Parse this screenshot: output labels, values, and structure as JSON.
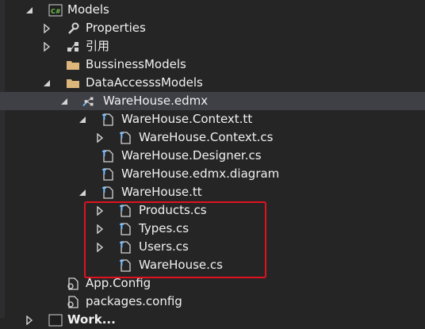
{
  "tree": {
    "items": [
      {
        "label": "Models",
        "icon": "csharp-project-icon",
        "expander": "expanded"
      },
      {
        "label": "Properties",
        "icon": "wrench-icon",
        "expander": "collapsed"
      },
      {
        "label": "引用",
        "icon": "references-icon",
        "expander": "collapsed"
      },
      {
        "label": "BussinessModels",
        "icon": "folder-icon",
        "expander": "none"
      },
      {
        "label": "DataAccesssModels",
        "icon": "folder-icon",
        "expander": "expanded"
      },
      {
        "label": "WareHouse.edmx",
        "icon": "edmx-icon",
        "expander": "expanded",
        "selected": true
      },
      {
        "label": "WareHouse.Context.tt",
        "icon": "tt-file-icon",
        "expander": "expanded"
      },
      {
        "label": "WareHouse.Context.cs",
        "icon": "cs-file-icon",
        "expander": "collapsed"
      },
      {
        "label": "WareHouse.Designer.cs",
        "icon": "cs-file-icon",
        "expander": "none"
      },
      {
        "label": "WareHouse.edmx.diagram",
        "icon": "cs-file-icon",
        "expander": "none"
      },
      {
        "label": "WareHouse.tt",
        "icon": "tt-file-icon",
        "expander": "expanded"
      },
      {
        "label": "Products.cs",
        "icon": "cs-file-icon",
        "expander": "collapsed"
      },
      {
        "label": "Types.cs",
        "icon": "cs-file-icon",
        "expander": "collapsed"
      },
      {
        "label": "Users.cs",
        "icon": "cs-file-icon",
        "expander": "collapsed"
      },
      {
        "label": "WareHouse.cs",
        "icon": "cs-file-icon",
        "expander": "none"
      },
      {
        "label": "App.Config",
        "icon": "config-file-icon",
        "expander": "none"
      },
      {
        "label": "packages.config",
        "icon": "config-file-icon",
        "expander": "none"
      },
      {
        "label": "Work...",
        "icon": "csharp-project-icon",
        "expander": "collapsed"
      }
    ]
  },
  "colors": {
    "background": "#252526",
    "selected_row": "#3f3f46",
    "text": "#f1f1f1",
    "highlight_border": "#e0121e",
    "folder": "#dcb67a",
    "file_accent": "#75beff"
  }
}
